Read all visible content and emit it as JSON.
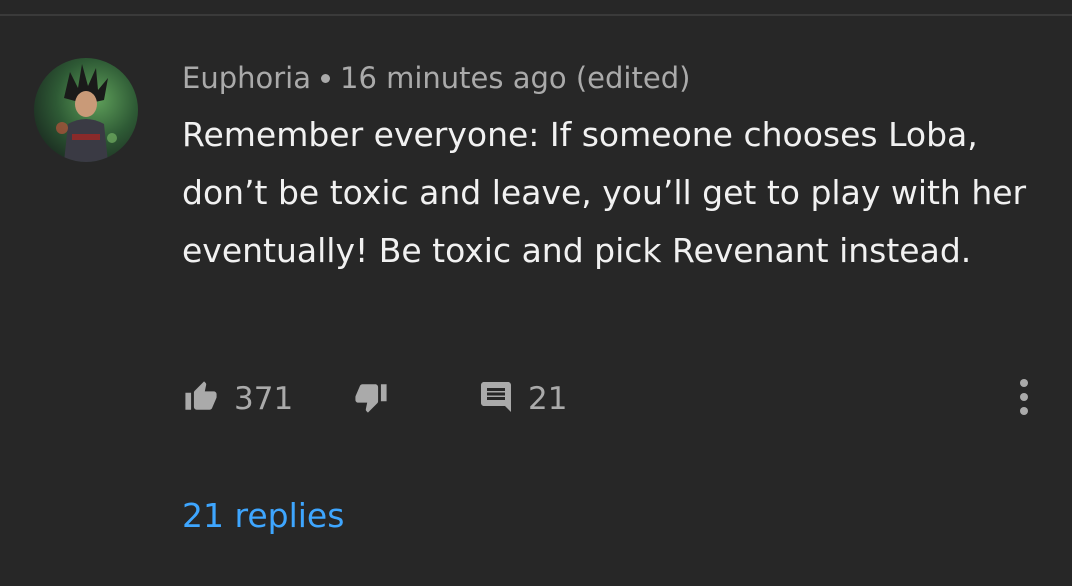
{
  "comment": {
    "author": "Euphoria",
    "timestamp": "16 minutes ago (edited)",
    "text": "Remember everyone: If someone chooses Loba, don’t be toxic and leave, you’ll get to play with her eventually! Be toxic and pick Revenant instead.",
    "like_count": "371",
    "reply_count": "21",
    "replies_link": "21 replies"
  },
  "icons": {
    "like": "thumbs-up-icon",
    "dislike": "thumbs-down-icon",
    "reply": "comment-icon",
    "more": "vertical-ellipsis-icon"
  },
  "colors": {
    "background": "#272727",
    "primary_text": "#f1f1f1",
    "secondary_text": "#aaaaaa",
    "link": "#3ea6ff"
  }
}
